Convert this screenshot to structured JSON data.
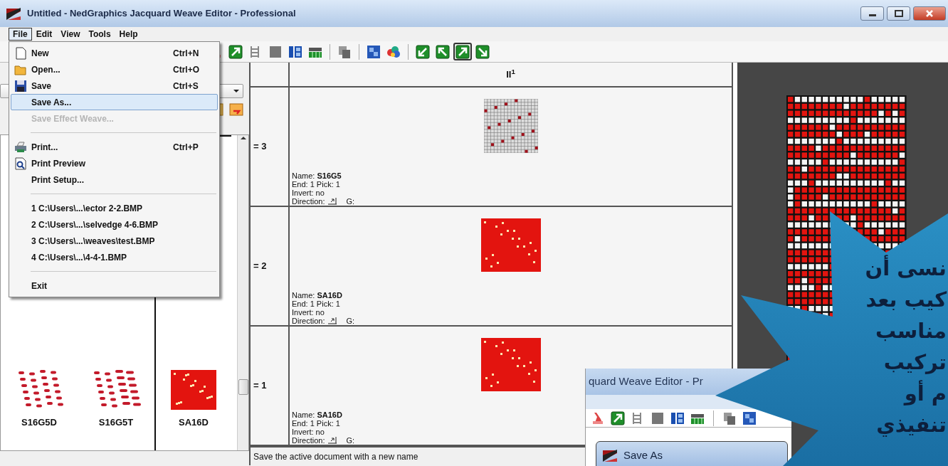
{
  "window": {
    "title": "Untitled - NedGraphics Jacquard Weave Editor - Professional"
  },
  "menu_bar": [
    {
      "label": "File",
      "selected": true
    },
    {
      "label": "Edit",
      "selected": false
    },
    {
      "label": "View",
      "selected": false
    },
    {
      "label": "Tools",
      "selected": false
    },
    {
      "label": "Help",
      "selected": false
    }
  ],
  "file_menu": [
    {
      "kind": "item",
      "label": "New",
      "shortcut": "Ctrl+N",
      "disabled": false,
      "selected": false
    },
    {
      "kind": "item",
      "label": "Open...",
      "shortcut": "Ctrl+O",
      "disabled": false,
      "selected": false
    },
    {
      "kind": "item",
      "label": "Save",
      "shortcut": "Ctrl+S",
      "disabled": false,
      "selected": false
    },
    {
      "kind": "item",
      "label": "Save As...",
      "disabled": false,
      "selected": true
    },
    {
      "kind": "item",
      "label": "Save Effect Weave...",
      "disabled": true,
      "selected": false
    },
    {
      "kind": "separator"
    },
    {
      "kind": "item",
      "label": "Print...",
      "shortcut": "Ctrl+P",
      "disabled": false,
      "selected": false
    },
    {
      "kind": "item",
      "label": "Print Preview",
      "disabled": false,
      "selected": false
    },
    {
      "kind": "item",
      "label": "Print Setup...",
      "disabled": false,
      "selected": false
    },
    {
      "kind": "separator"
    },
    {
      "kind": "item",
      "label": "1 C:\\Users\\...\\ector 2-2.BMP",
      "disabled": false,
      "selected": false
    },
    {
      "kind": "item",
      "label": "2 C:\\Users\\...\\selvedge 4-6.BMP",
      "disabled": false,
      "selected": false
    },
    {
      "kind": "item",
      "label": "3 C:\\Users\\...\\weaves\\test.BMP",
      "disabled": false,
      "selected": false
    },
    {
      "kind": "item",
      "label": "4 C:\\Users\\...\\4-4-1.BMP",
      "disabled": false,
      "selected": false
    },
    {
      "kind": "separator"
    },
    {
      "kind": "item",
      "label": "Exit",
      "disabled": false,
      "selected": false
    }
  ],
  "toolbar": [
    {
      "kind": "button",
      "selected": false
    },
    {
      "kind": "button",
      "selected": false
    },
    {
      "kind": "button",
      "selected": false
    },
    {
      "kind": "button",
      "selected": false
    },
    {
      "kind": "button",
      "selected": false
    },
    {
      "kind": "button",
      "selected": false
    },
    {
      "kind": "separator"
    },
    {
      "kind": "button",
      "selected": false
    },
    {
      "kind": "separator"
    },
    {
      "kind": "button",
      "selected": false
    },
    {
      "kind": "button",
      "selected": false
    },
    {
      "kind": "separator"
    },
    {
      "kind": "button",
      "selected": false
    },
    {
      "kind": "button",
      "selected": false
    },
    {
      "kind": "button",
      "selected": true
    },
    {
      "kind": "button",
      "selected": false
    }
  ],
  "left_panel": {
    "thumbnails": [
      {
        "name": "S16G5D",
        "kind": "dashes",
        "selected": false
      },
      {
        "name": "S16G5T",
        "kind": "dashes",
        "selected": false
      },
      {
        "name": "SA16D",
        "kind": "solid",
        "selected": true
      }
    ]
  },
  "weave_table": {
    "header": "II$^{1}$",
    "rows": [
      {
        "label": "= 3",
        "kind": "grid",
        "name": "Name: **S16G5**",
        "end_pick": "End: 1 Pick: 1",
        "invert": "Invert: no",
        "direction": "Direction:",
        "g": "G:"
      },
      {
        "label": "= 2",
        "kind": "solid",
        "name": "Name: **SA16D**",
        "end_pick": "End: 1 Pick: 1",
        "invert": "Invert: no",
        "direction": "Direction:",
        "g": "G:"
      },
      {
        "label": "= 1",
        "kind": "solid",
        "name": "Name: **SA16D**",
        "end_pick": "End: 1 Pick: 1",
        "invert": "Invert: no",
        "direction": "Direction:",
        "g": "G:"
      }
    ]
  },
  "status_bar": "Save the active document with a new name",
  "second_window": {
    "title": "quard Weave Editor - Pr",
    "dialog_title": "Save As"
  },
  "callout": {
    "lines": [
      "نسى أن",
      "كيب بعد",
      "مناسب",
      "تركيب",
      "م أو",
      "تنفيذي"
    ]
  }
}
